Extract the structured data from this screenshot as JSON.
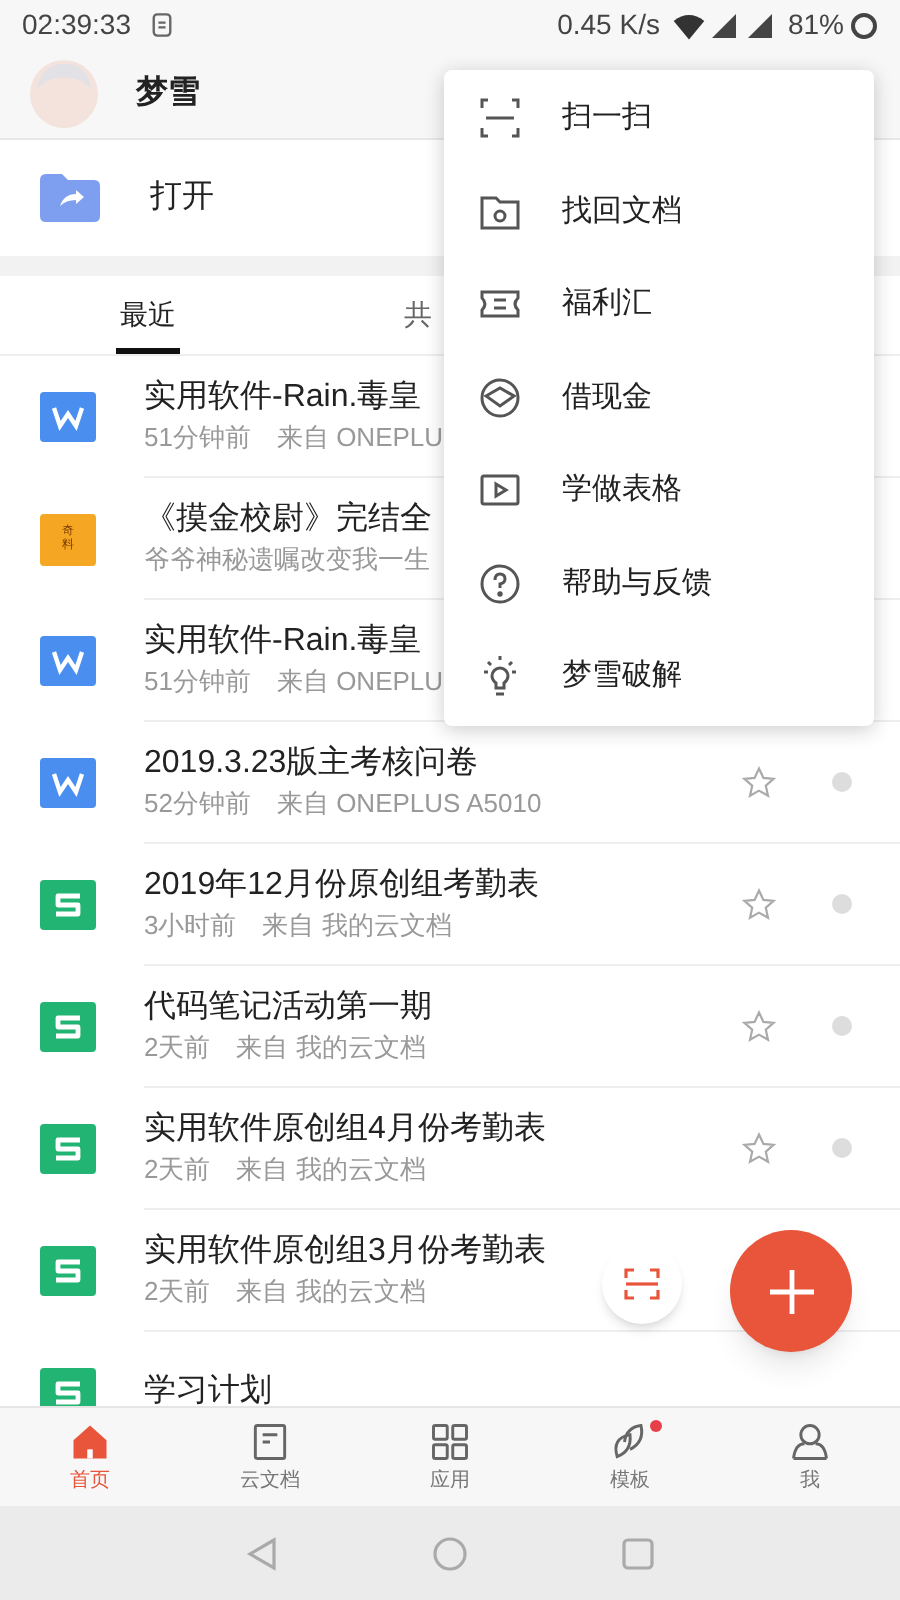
{
  "status_bar": {
    "time": "02:39:33",
    "speed": "0.45 K/s",
    "battery": "81%"
  },
  "header": {
    "username": "梦雪"
  },
  "open_row": {
    "label": "打开"
  },
  "tabs": [
    {
      "label": "最近",
      "selected": true
    },
    {
      "label": "共",
      "selected": false
    }
  ],
  "files": [
    {
      "kind": "writer",
      "title": "实用软件-Rain.毒皇",
      "meta": "51分钟前　来自 ONEPLU"
    },
    {
      "kind": "novel",
      "badge": "奇料",
      "title": "《摸金校尉》完结全",
      "meta": "爷爷神秘遗嘱改变我一生"
    },
    {
      "kind": "writer",
      "title": "实用软件-Rain.毒皇",
      "meta": "51分钟前　来自 ONEPLU"
    },
    {
      "kind": "writer",
      "title": "2019.3.23版主考核问卷",
      "meta": "52分钟前　来自 ONEPLUS A5010",
      "actions_visible": true
    },
    {
      "kind": "sheet",
      "title": "2019年12月份原创组考勤表",
      "meta": "3小时前　来自 我的云文档",
      "actions_visible": true
    },
    {
      "kind": "sheet",
      "title": "代码笔记活动第一期",
      "meta": "2天前　来自 我的云文档",
      "actions_visible": true
    },
    {
      "kind": "sheet",
      "title": "实用软件原创组4月份考勤表",
      "meta": "2天前　来自 我的云文档",
      "actions_visible": true
    },
    {
      "kind": "sheet",
      "title": "实用软件原创组3月份考勤表",
      "meta": "2天前　来自 我的云文档"
    },
    {
      "kind": "sheet",
      "title": "学习计划"
    }
  ],
  "menu": [
    {
      "kind": "scan",
      "label": "扫一扫"
    },
    {
      "kind": "recover",
      "label": "找回文档"
    },
    {
      "kind": "ticket",
      "label": "福利汇"
    },
    {
      "kind": "loan",
      "label": "借现金"
    },
    {
      "kind": "video",
      "label": "学做表格"
    },
    {
      "kind": "help",
      "label": "帮助与反馈"
    },
    {
      "kind": "bulb",
      "label": "梦雪破解"
    }
  ],
  "bottom_nav": [
    {
      "kind": "home",
      "label": "首页",
      "selected": true,
      "badge": false
    },
    {
      "kind": "cloud",
      "label": "云文档",
      "selected": false,
      "badge": false
    },
    {
      "kind": "apps",
      "label": "应用",
      "selected": false,
      "badge": false
    },
    {
      "kind": "templates",
      "label": "模板",
      "selected": false,
      "badge": true
    },
    {
      "kind": "me",
      "label": "我",
      "selected": false,
      "badge": false
    }
  ]
}
